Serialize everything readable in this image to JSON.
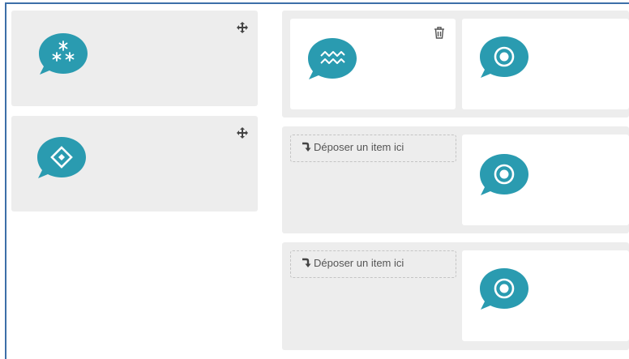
{
  "colors": {
    "accent": "#2a9bb0",
    "panel": "#ededed",
    "slot": "#ffffff",
    "frame": "#3d6fa8"
  },
  "source_items": [
    {
      "icon": "snowflake-asterisks-icon"
    },
    {
      "icon": "diamond-in-diamond-icon"
    }
  ],
  "target_rows": [
    {
      "placed_icon": "waves-icon",
      "answer_icon": "target-circle-icon"
    },
    {
      "drop_label": "Déposer un item ici",
      "answer_icon": "target-circle-icon"
    },
    {
      "drop_label": "Déposer un item ici",
      "answer_icon": "target-circle-icon"
    }
  ],
  "icons": {
    "move": "move-arrows-icon",
    "delete": "trash-icon",
    "drop_arrow": "curved-arrow-down-icon"
  }
}
